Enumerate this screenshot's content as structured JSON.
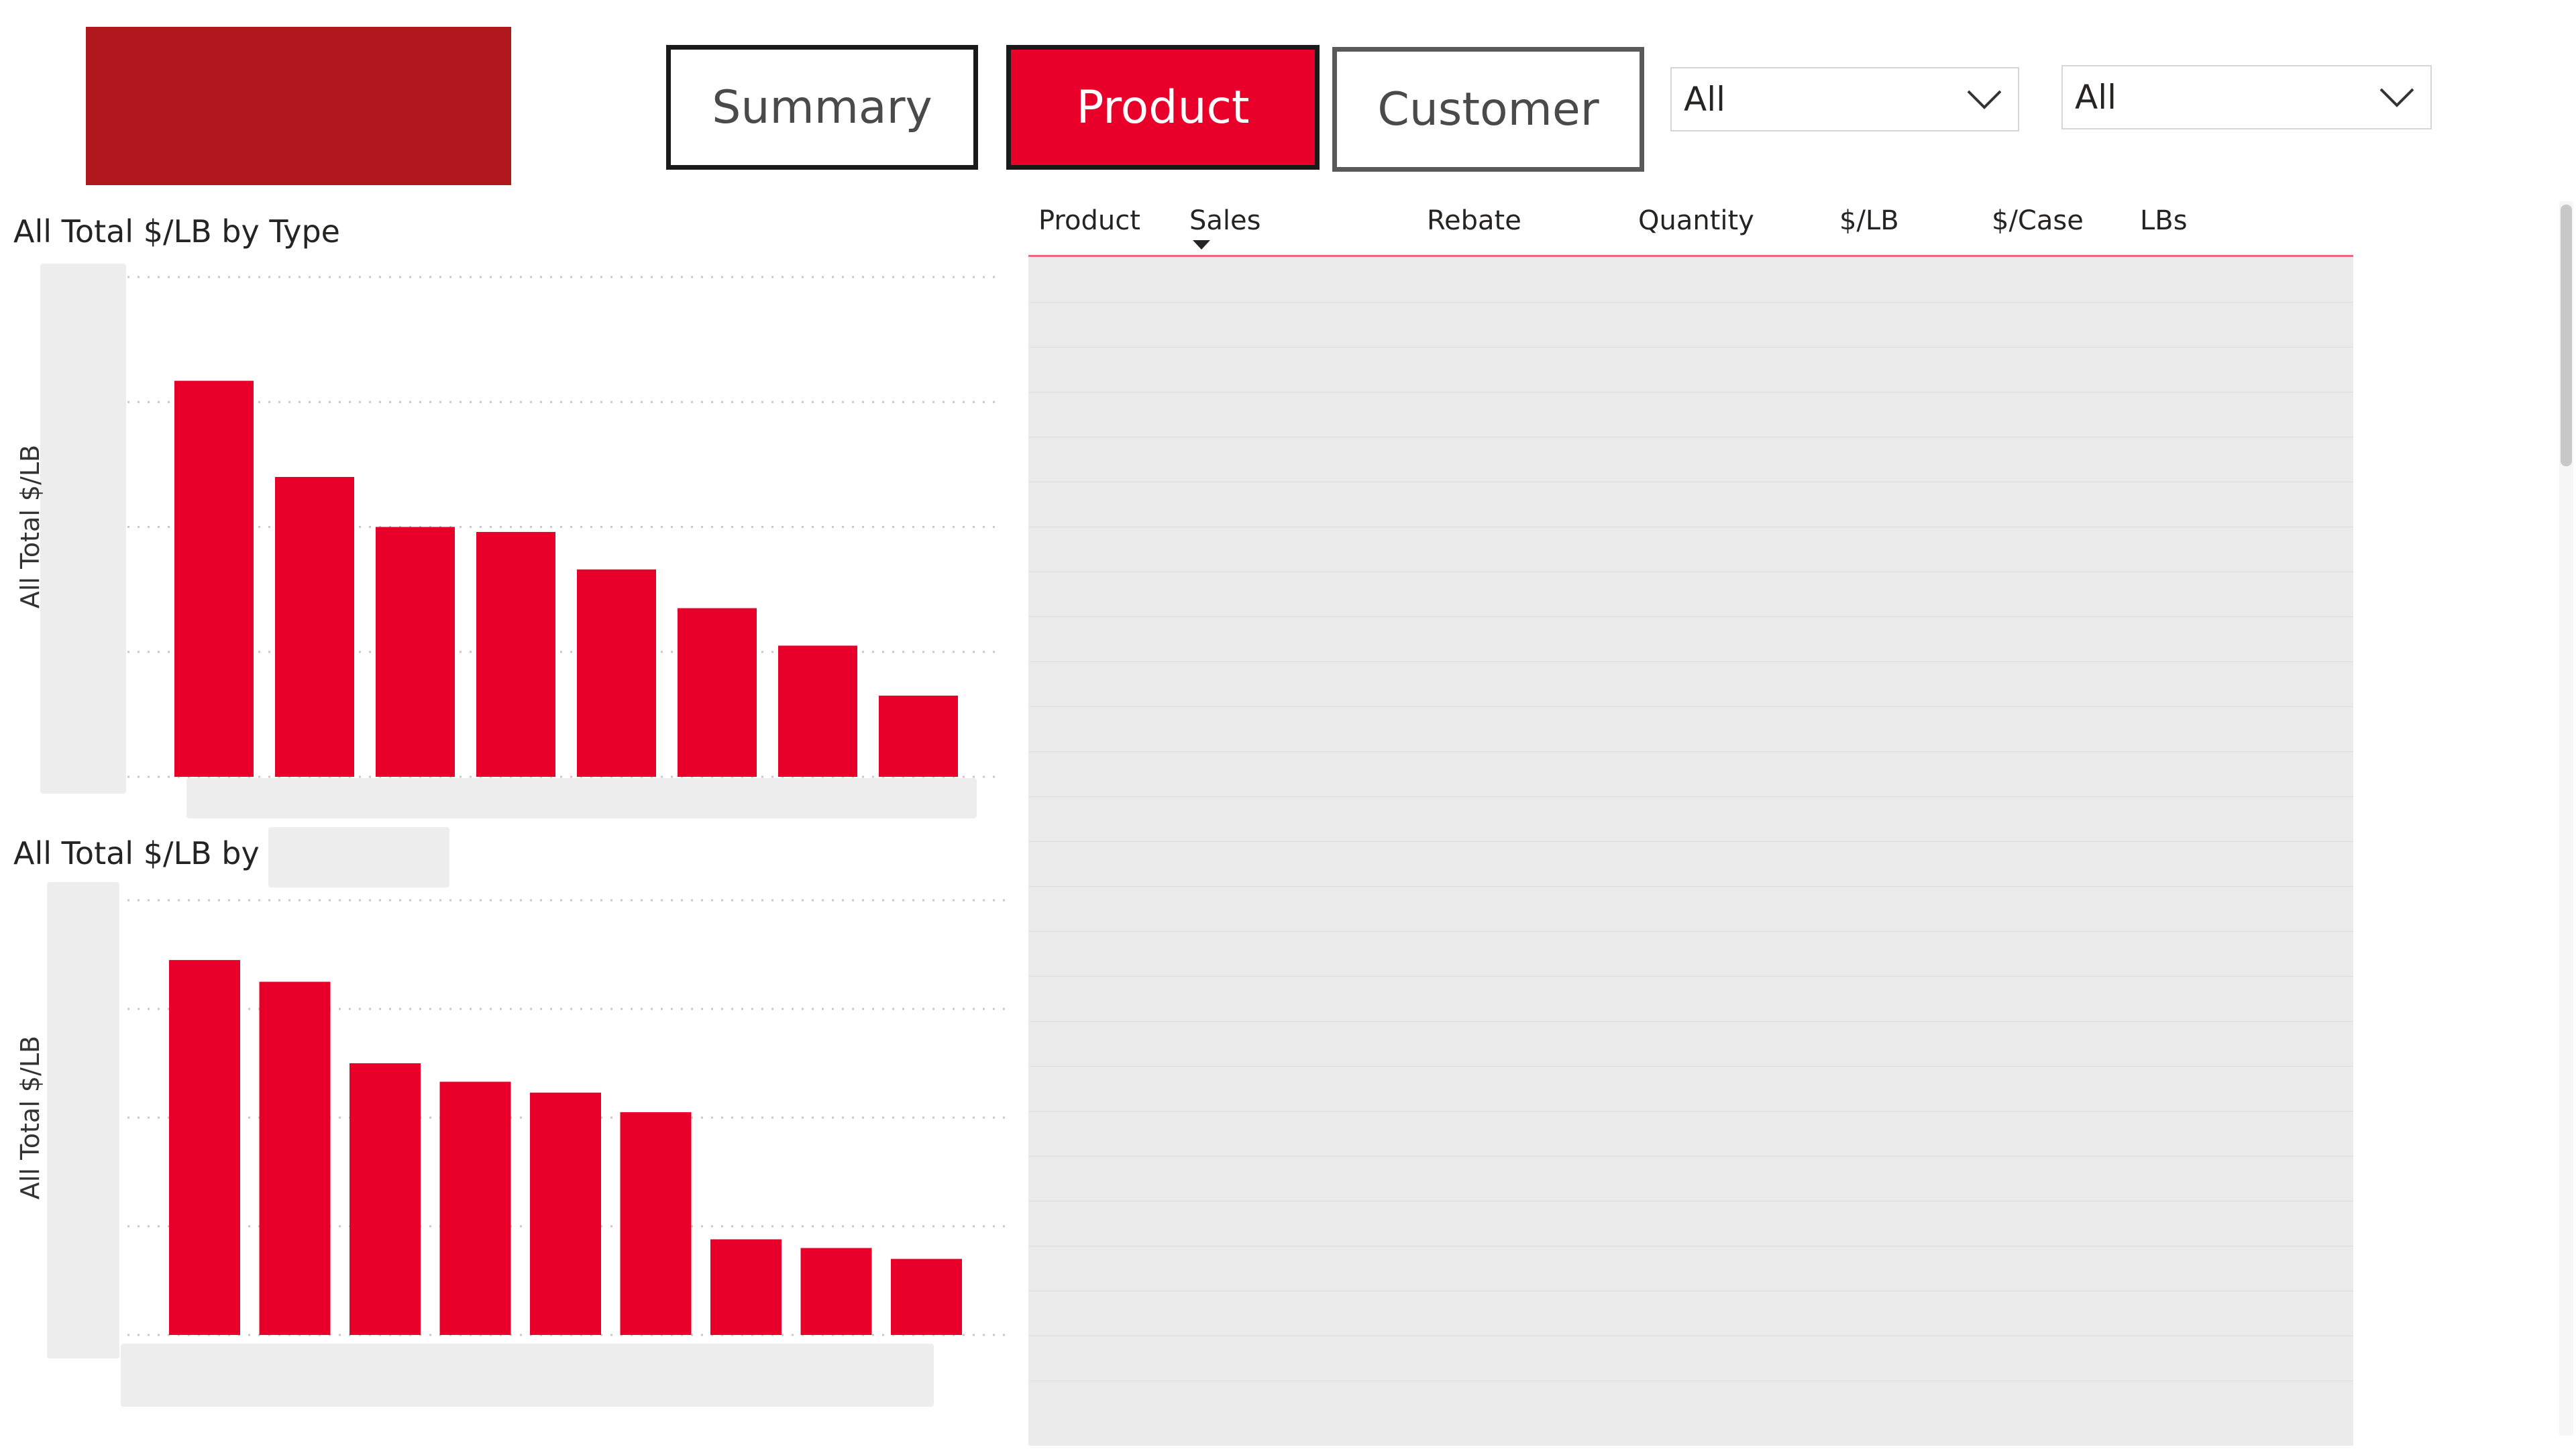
{
  "colors": {
    "accent": "#e8002a",
    "logo": "#b0181e"
  },
  "nav": {
    "summary_label": "Summary",
    "product_label": "Product",
    "customer_label": "Customer",
    "active": "Product"
  },
  "filters": [
    {
      "value": "All",
      "icon": "chevron-down-icon"
    },
    {
      "value": "All",
      "icon": "chevron-down-icon"
    }
  ],
  "chart1": {
    "title": "All Total $/LB by Type",
    "ylabel": "All Total $/LB"
  },
  "chart2": {
    "title": "All Total $/LB by",
    "ylabel": "All Total $/LB"
  },
  "chart_data": [
    {
      "type": "bar",
      "title": "All Total $/LB by Type",
      "ylabel": "All Total $/LB",
      "grid": true,
      "categories": [],
      "values": [
        3.17,
        2.4,
        2.0,
        1.96,
        1.66,
        1.35,
        1.05,
        0.65
      ],
      "ylim": [
        0,
        4
      ]
    },
    {
      "type": "bar",
      "title": "All Total $/LB by",
      "ylabel": "All Total $/LB",
      "grid": true,
      "categories": [],
      "values": [
        3.45,
        3.25,
        2.5,
        2.33,
        2.23,
        2.05,
        0.88,
        0.8,
        0.7
      ],
      "ylim": [
        0,
        4
      ]
    }
  ],
  "table": {
    "columns": [
      "Product",
      "Sales",
      "Rebate",
      "Quantity",
      "$/LB",
      "$/Case",
      "LBs"
    ],
    "sort_column": "Sales",
    "sort_direction": "descending"
  }
}
